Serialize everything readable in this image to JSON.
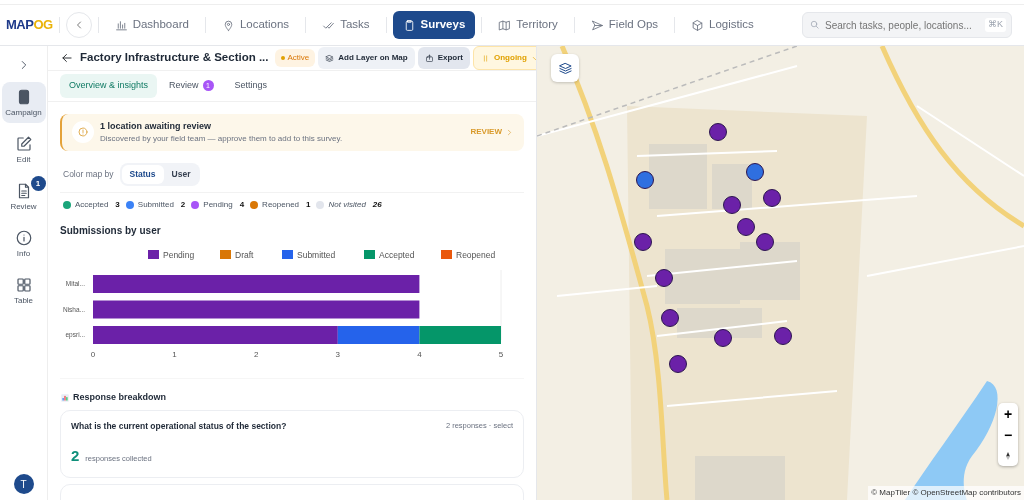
{
  "logo": {
    "part_1": "MAP",
    "part_2": "OG"
  },
  "nav": [
    {
      "label": "Dashboard",
      "selected": false
    },
    {
      "label": "Locations",
      "selected": false
    },
    {
      "label": "Tasks",
      "selected": false
    },
    {
      "label": "Surveys",
      "selected": true
    },
    {
      "label": "Territory",
      "selected": false
    },
    {
      "label": "Field Ops",
      "selected": false
    },
    {
      "label": "Logistics",
      "selected": false
    }
  ],
  "search": {
    "placeholder": "Search tasks, people, locations...",
    "shortcut": "⌘K"
  },
  "rail": [
    {
      "label": "Campaign",
      "selected": true
    },
    {
      "label": "Edit",
      "selected": false
    },
    {
      "label": "Review",
      "selected": false,
      "badge": "1"
    },
    {
      "label": "Info",
      "selected": false
    },
    {
      "label": "Table",
      "selected": false
    }
  ],
  "avatar": "T",
  "header": {
    "title": "Factory Infrastructure & Section ...",
    "status": "Active",
    "add_layer": "Add Layer on Map",
    "export": "Export",
    "state": "Ongoing"
  },
  "tabs": [
    {
      "label": "Overview & insights",
      "selected": true
    },
    {
      "label": "Review",
      "selected": false,
      "badge": "1"
    },
    {
      "label": "Settings",
      "selected": false
    }
  ],
  "alert": {
    "title": "1 location awaiting review",
    "text": "Discovered by your field team — approve them to add to this survey.",
    "action": "REVIEW"
  },
  "color_map": {
    "label": "Color map by",
    "options": [
      {
        "label": "Status",
        "selected": true
      },
      {
        "label": "User",
        "selected": false
      }
    ]
  },
  "statuses": [
    {
      "label": "Accepted",
      "count": "3",
      "color": "#1aa57a"
    },
    {
      "label": "Submitted",
      "count": "2",
      "color": "#3b82f6"
    },
    {
      "label": "Pending",
      "count": "4",
      "color": "#a855f7"
    },
    {
      "label": "Reopened",
      "count": "1",
      "color": "#d97706"
    },
    {
      "label": "Not visited",
      "count": "26",
      "color": "#e2e5ec"
    }
  ],
  "submissions": {
    "title": "Submissions by user",
    "chart_data": {
      "type": "bar",
      "orientation": "horizontal",
      "stacked": true,
      "categories": [
        "Mital...",
        "Nisha...",
        "epsri..."
      ],
      "series": [
        {
          "name": "Pending",
          "color": "#6b21a8",
          "values": [
            4,
            4,
            3
          ]
        },
        {
          "name": "Draft",
          "color": "#d97706",
          "values": [
            0,
            0,
            0
          ]
        },
        {
          "name": "Submitted",
          "color": "#2563eb",
          "values": [
            0,
            0,
            1
          ]
        },
        {
          "name": "Accepted",
          "color": "#059669",
          "values": [
            0,
            0,
            1
          ]
        },
        {
          "name": "Reopened",
          "color": "#ea580c",
          "values": [
            0,
            0,
            0
          ]
        }
      ],
      "xlim": [
        0,
        5
      ],
      "xticks": [
        0,
        1,
        2,
        3,
        4,
        5
      ],
      "legend": "top"
    }
  },
  "breakdown": {
    "title": "Response breakdown",
    "questions": [
      {
        "question": "What is the current operational status of the section?",
        "meta": "2 responses · select",
        "count": "2",
        "count_label": "responses collected"
      }
    ]
  },
  "map": {
    "markers": [
      {
        "color": "#6b21a8"
      },
      {
        "color": "#2f6fe0"
      },
      {
        "color": "#2f6fe0"
      },
      {
        "color": "#6b21a8"
      },
      {
        "color": "#6b21a8"
      },
      {
        "color": "#6b21a8"
      },
      {
        "color": "#6b21a8"
      },
      {
        "color": "#6b21a8"
      },
      {
        "color": "#6b21a8"
      },
      {
        "color": "#6b21a8"
      },
      {
        "color": "#6b21a8"
      },
      {
        "color": "#6b21a8"
      },
      {
        "color": "#6b21a8"
      }
    ],
    "zoom_in": "+",
    "zoom_out": "−",
    "attribution": "© MapTiler © OpenStreetMap contributors"
  }
}
